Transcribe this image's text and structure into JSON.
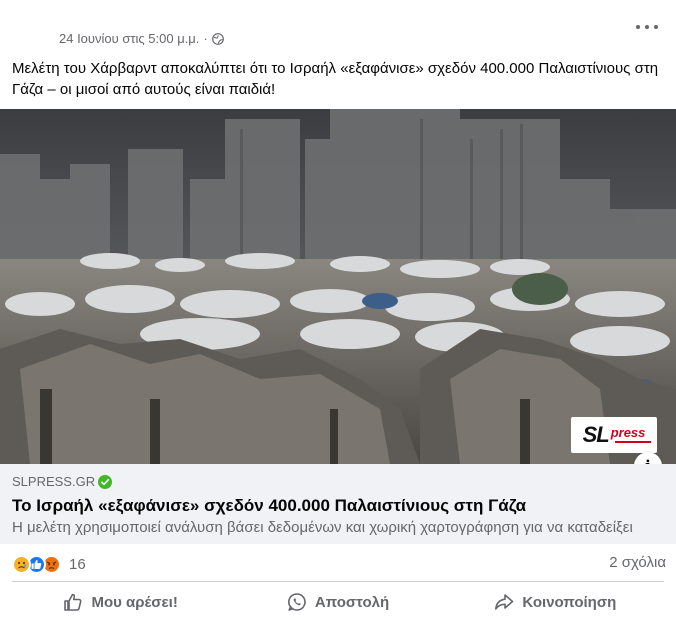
{
  "header": {
    "timestamp": "24 Ιουνίου στις 5:00 μ.μ.",
    "separator": "·",
    "privacy_icon": "globe-icon",
    "more_icon": "more-options-icon"
  },
  "message": "Μελέτη του Χάρβαρντ αποκαλύπτει ότι το Ισραήλ «εξαφάνισε» σχεδόν 400.000 Παλαιστίνιους στη Γάζα – οι μισοί από αυτούς είναι παιδιά!",
  "image": {
    "watermark_sl": "SL",
    "watermark_press": "press",
    "info_label": "i"
  },
  "link_preview": {
    "domain": "SLPRESS.GR",
    "verified_icon": "verified-check-icon",
    "title": "Το Ισραήλ «εξαφάνισε» σχεδόν 400.000 Παλαιστίνιους στη Γάζα",
    "description": "Η μελέτη χρησιμοποιεί ανάλυση βάσει δεδομένων και χωρική χαρτογράφηση για να καταδείξει"
  },
  "reactions": {
    "icons": [
      "sad-reaction-icon",
      "like-reaction-icon",
      "angry-reaction-icon"
    ],
    "count": "16",
    "comments": "2 σχόλια"
  },
  "actions": {
    "like": "Μου αρέσει!",
    "send": "Αποστολή",
    "share": "Κοινοποίηση"
  },
  "colors": {
    "secondary_text": "#65676b",
    "preview_bg": "#f0f2f5",
    "like_blue": "#1877f2",
    "verified_green": "#42b72a",
    "sad_yellow": "#f7b125",
    "angry_orange": "#e9710f"
  }
}
